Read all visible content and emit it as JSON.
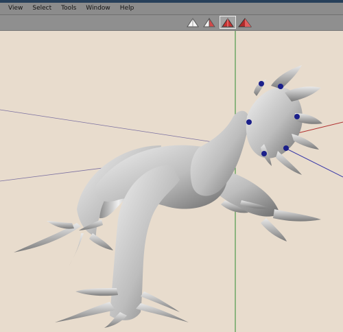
{
  "app": {
    "menus": [
      "View",
      "Select",
      "Tools",
      "Window",
      "Help"
    ]
  },
  "toolbar": {
    "buttons": [
      {
        "icon": "cone-white-icon",
        "selected": false
      },
      {
        "icon": "cone-white-red-icon",
        "selected": false
      },
      {
        "icon": "cone-red-icon",
        "selected": true
      },
      {
        "icon": "cone-red-shaded-icon",
        "selected": false
      }
    ]
  },
  "viewport": {
    "background": "#e8dccd",
    "model_color": "#bdbdbd",
    "handle_color": "#1b1f8a",
    "axis_colors": {
      "y": "#2e8b2e",
      "x": "#b03030",
      "z": "#3a3aa8"
    }
  }
}
